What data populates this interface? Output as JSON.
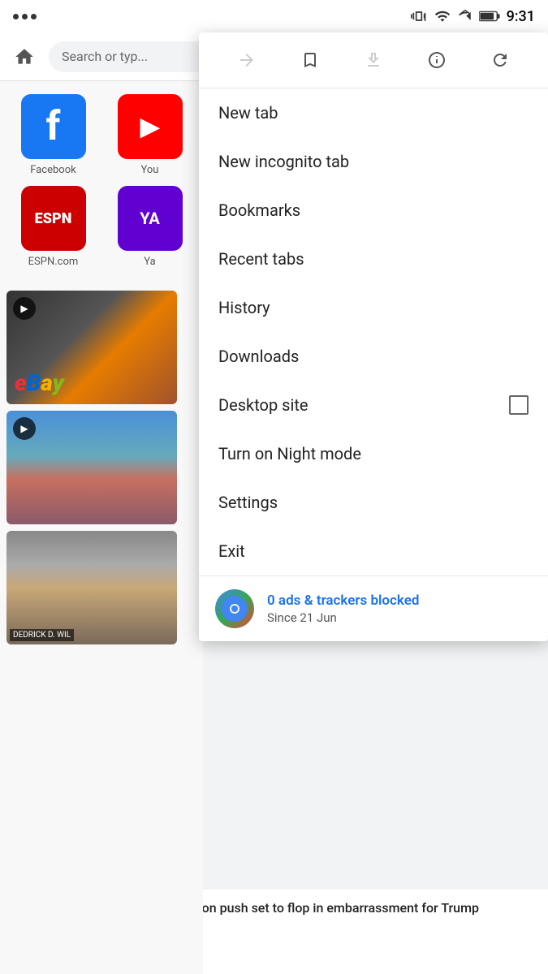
{
  "statusBar": {
    "time": "9:31"
  },
  "toolbar": {
    "searchPlaceholder": "Search or typ..."
  },
  "shortcuts": [
    {
      "label": "Facebook",
      "type": "facebook"
    },
    {
      "label": "You",
      "type": "youtube"
    },
    {
      "label": "ESPN.com",
      "type": "espn"
    },
    {
      "label": "Ya",
      "type": "yahoo"
    }
  ],
  "menu": {
    "items": [
      {
        "id": "new-tab",
        "label": "New tab",
        "hasCheckbox": false
      },
      {
        "id": "new-incognito",
        "label": "New incognito tab",
        "hasCheckbox": false
      },
      {
        "id": "bookmarks",
        "label": "Bookmarks",
        "hasCheckbox": false
      },
      {
        "id": "recent-tabs",
        "label": "Recent tabs",
        "hasCheckbox": false
      },
      {
        "id": "history",
        "label": "History",
        "hasCheckbox": false
      },
      {
        "id": "downloads",
        "label": "Downloads",
        "hasCheckbox": false
      },
      {
        "id": "desktop-site",
        "label": "Desktop site",
        "hasCheckbox": true
      },
      {
        "id": "night-mode",
        "label": "Turn on Night mode",
        "hasCheckbox": false
      },
      {
        "id": "settings",
        "label": "Settings",
        "hasCheckbox": false
      },
      {
        "id": "exit",
        "label": "Exit",
        "hasCheckbox": false
      }
    ],
    "adsBlocked": {
      "count": "0 ads & trackers blocked",
      "since": "Since 21 Jun"
    }
  },
  "bottomNews": {
    "headline": "GOP immigration push set to flop in embarrassment for Trump"
  }
}
